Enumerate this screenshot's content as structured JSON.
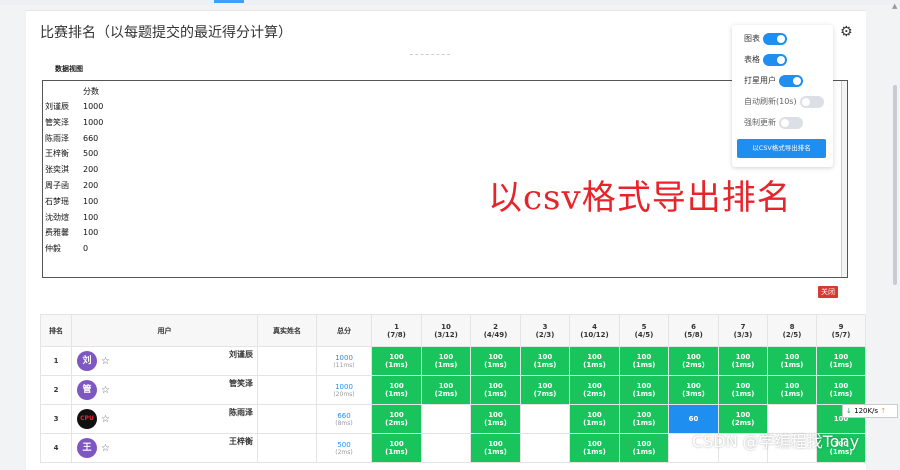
{
  "page": {
    "title": "比赛排名（以每题提交的最近得分计算）",
    "gear_icon": "gear-icon"
  },
  "data_view": {
    "label": "数据视图",
    "header": "分数",
    "rows": [
      {
        "name": "刘谨辰",
        "score": "1000"
      },
      {
        "name": "管笑泽",
        "score": "1000"
      },
      {
        "name": "陈雨泽",
        "score": "660"
      },
      {
        "name": "王梓衡",
        "score": "500"
      },
      {
        "name": "张奕淇",
        "score": "200"
      },
      {
        "name": "周子函",
        "score": "200"
      },
      {
        "name": "石梦瑶",
        "score": "100"
      },
      {
        "name": "沈劲煊",
        "score": "100"
      },
      {
        "name": "费雅馨",
        "score": "100"
      },
      {
        "name": "仲毅",
        "score": "0"
      }
    ],
    "close_label": "关闭"
  },
  "annotation": "以csv格式导出排名",
  "panel": {
    "items": [
      {
        "label": "图表",
        "on": true
      },
      {
        "label": "表格",
        "on": true
      },
      {
        "label": "打星用户",
        "on": true
      },
      {
        "label": "自动刷新(10s)",
        "on": false
      },
      {
        "label": "强制更新",
        "on": false
      }
    ],
    "export_label": "以CSV格式导出排名"
  },
  "table": {
    "headers": {
      "rank": "排名",
      "user": "用户",
      "realname": "真实姓名",
      "total": "总分"
    },
    "problems": [
      {
        "id": "1",
        "ratio": "(7/8)"
      },
      {
        "id": "10",
        "ratio": "(3/12)"
      },
      {
        "id": "2",
        "ratio": "(4/49)"
      },
      {
        "id": "3",
        "ratio": "(2/3)"
      },
      {
        "id": "4",
        "ratio": "(10/12)"
      },
      {
        "id": "5",
        "ratio": "(4/5)"
      },
      {
        "id": "6",
        "ratio": "(5/8)"
      },
      {
        "id": "7",
        "ratio": "(3/3)"
      },
      {
        "id": "8",
        "ratio": "(2/5)"
      },
      {
        "id": "9",
        "ratio": "(5/7)"
      }
    ],
    "rows": [
      {
        "rank": "1",
        "avatar": "刘",
        "name": "刘谨辰",
        "total": "1000",
        "time": "(11ms)",
        "cells": [
          [
            "100",
            "(1ms)",
            "g"
          ],
          [
            "100",
            "(1ms)",
            "g"
          ],
          [
            "100",
            "(1ms)",
            "g"
          ],
          [
            "100",
            "(1ms)",
            "g"
          ],
          [
            "100",
            "(1ms)",
            "g"
          ],
          [
            "100",
            "(1ms)",
            "g"
          ],
          [
            "100",
            "(2ms)",
            "g"
          ],
          [
            "100",
            "(1ms)",
            "g"
          ],
          [
            "100",
            "(1ms)",
            "g"
          ],
          [
            "100",
            "(1ms)",
            "g"
          ]
        ]
      },
      {
        "rank": "2",
        "avatar": "管",
        "name": "管笑泽",
        "total": "1000",
        "time": "(20ms)",
        "cells": [
          [
            "100",
            "(1ms)",
            "g"
          ],
          [
            "100",
            "(2ms)",
            "g"
          ],
          [
            "100",
            "(1ms)",
            "g"
          ],
          [
            "100",
            "(7ms)",
            "g"
          ],
          [
            "100",
            "(2ms)",
            "g"
          ],
          [
            "100",
            "(1ms)",
            "g"
          ],
          [
            "100",
            "(3ms)",
            "g"
          ],
          [
            "100",
            "(1ms)",
            "g"
          ],
          [
            "100",
            "(1ms)",
            "g"
          ],
          [
            "100",
            "(1ms)",
            "g"
          ]
        ]
      },
      {
        "rank": "3",
        "avatar": "CPU",
        "name": "陈雨泽",
        "total": "660",
        "time": "(8ms)",
        "cells": [
          [
            "100",
            "(2ms)",
            "g"
          ],
          [
            "",
            "",
            ""
          ],
          [
            "100",
            "(1ms)",
            "g"
          ],
          [
            "",
            "",
            ""
          ],
          [
            "100",
            "(1ms)",
            "g"
          ],
          [
            "100",
            "(1ms)",
            "g"
          ],
          [
            "60",
            "",
            "b"
          ],
          [
            "100",
            "(2ms)",
            "g"
          ],
          [
            "",
            "",
            ""
          ],
          [
            "100",
            "",
            "g"
          ]
        ]
      },
      {
        "rank": "4",
        "avatar": "王",
        "name": "王梓衡",
        "total": "500",
        "time": "(2ms)",
        "cells": [
          [
            "100",
            "(1ms)",
            "g"
          ],
          [
            "",
            "",
            ""
          ],
          [
            "100",
            "(1ms)",
            "g"
          ],
          [
            "",
            "",
            ""
          ],
          [
            "100",
            "(1ms)",
            "g"
          ],
          [
            "100",
            "(1ms)",
            "g"
          ],
          [
            "",
            "",
            ""
          ],
          [
            "",
            "",
            ""
          ],
          [
            "",
            "",
            ""
          ],
          [
            "100",
            "(1ms)",
            "g"
          ]
        ]
      }
    ]
  },
  "speed": "120K/s",
  "watermark": "CSDN @学编程找Tony"
}
